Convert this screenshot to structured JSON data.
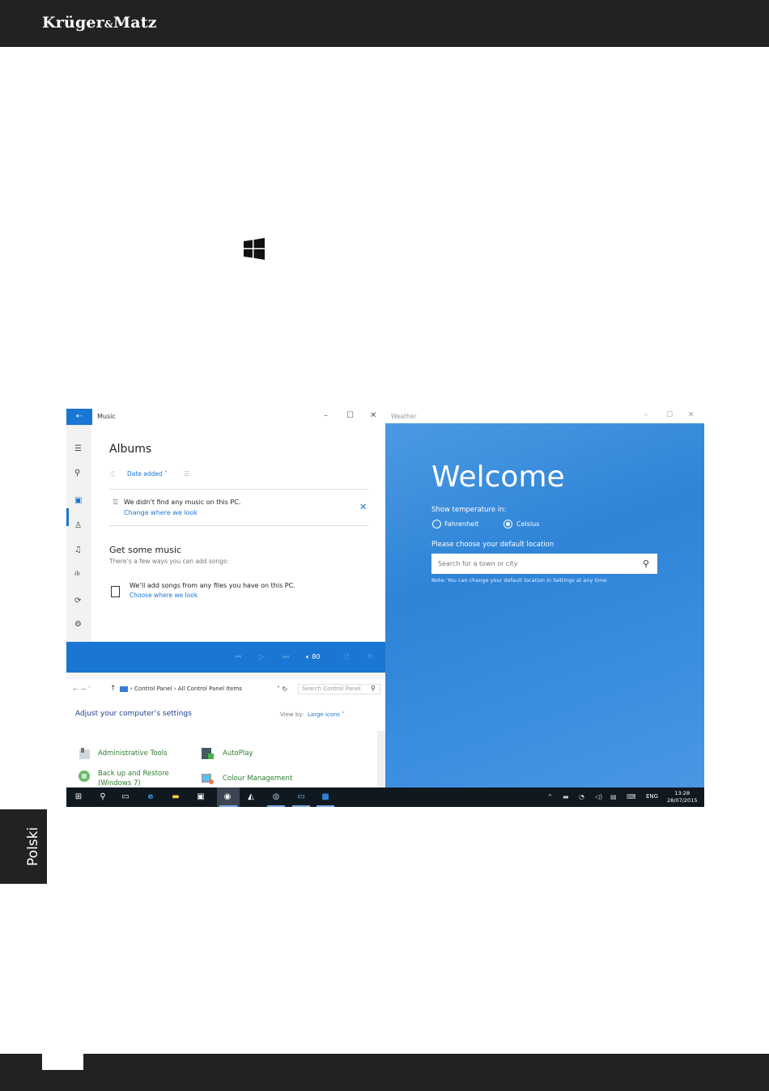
{
  "header": {
    "brand_main": "Krüger",
    "brand_amp": "&",
    "brand_tail": "Matz"
  },
  "side_tab": {
    "label": "Polski"
  },
  "colors": {
    "dark_bar": "#222222",
    "accent_blue": "#1976d2",
    "weather_blue": "#2f84d7"
  },
  "music": {
    "app_name": "Music",
    "heading": "Albums",
    "sort_label": "Date added ˅",
    "no_music_text": "We didn’t find any music on this PC.",
    "change_link": "Change where we look",
    "get_heading": "Get some music",
    "ways_text": "There’s a few ways you can add songs:",
    "add_text": "We’ll add songs from any files you have on this PC.",
    "choose_link": "Choose where we look",
    "volume": "80",
    "rail_icons": [
      "menu-icon",
      "search-icon",
      "albums-icon",
      "artists-icon",
      "songs-icon",
      "now-playing-icon",
      "sync-icon",
      "settings-icon"
    ]
  },
  "control_panel": {
    "breadcrumb_1": "Control Panel",
    "breadcrumb_sep": "›",
    "breadcrumb_2": "All Control Panel Items",
    "search_placeholder": "Search Control Panel",
    "adjust_title": "Adjust your computer’s settings",
    "view_by_label": "View by:",
    "view_by_value": "Large icons ˅",
    "items": [
      "Administrative Tools",
      "AutoPlay",
      "Back up and Restore",
      "(Windows 7)",
      "Colour Management"
    ]
  },
  "weather": {
    "app_name": "Weather",
    "welcome": "Welcome",
    "show_temp": "Show temperature in:",
    "fahrenheit": "Fahrenheit",
    "celsius": "Celsius",
    "selected_unit": "Celsius",
    "choose_location": "Please choose your default location",
    "search_placeholder": "Search for a town or city",
    "note": "Note: You can change your default location in Settings at any time."
  },
  "taskbar": {
    "language": "ENG",
    "time": "13:28",
    "date": "28/07/2015"
  }
}
